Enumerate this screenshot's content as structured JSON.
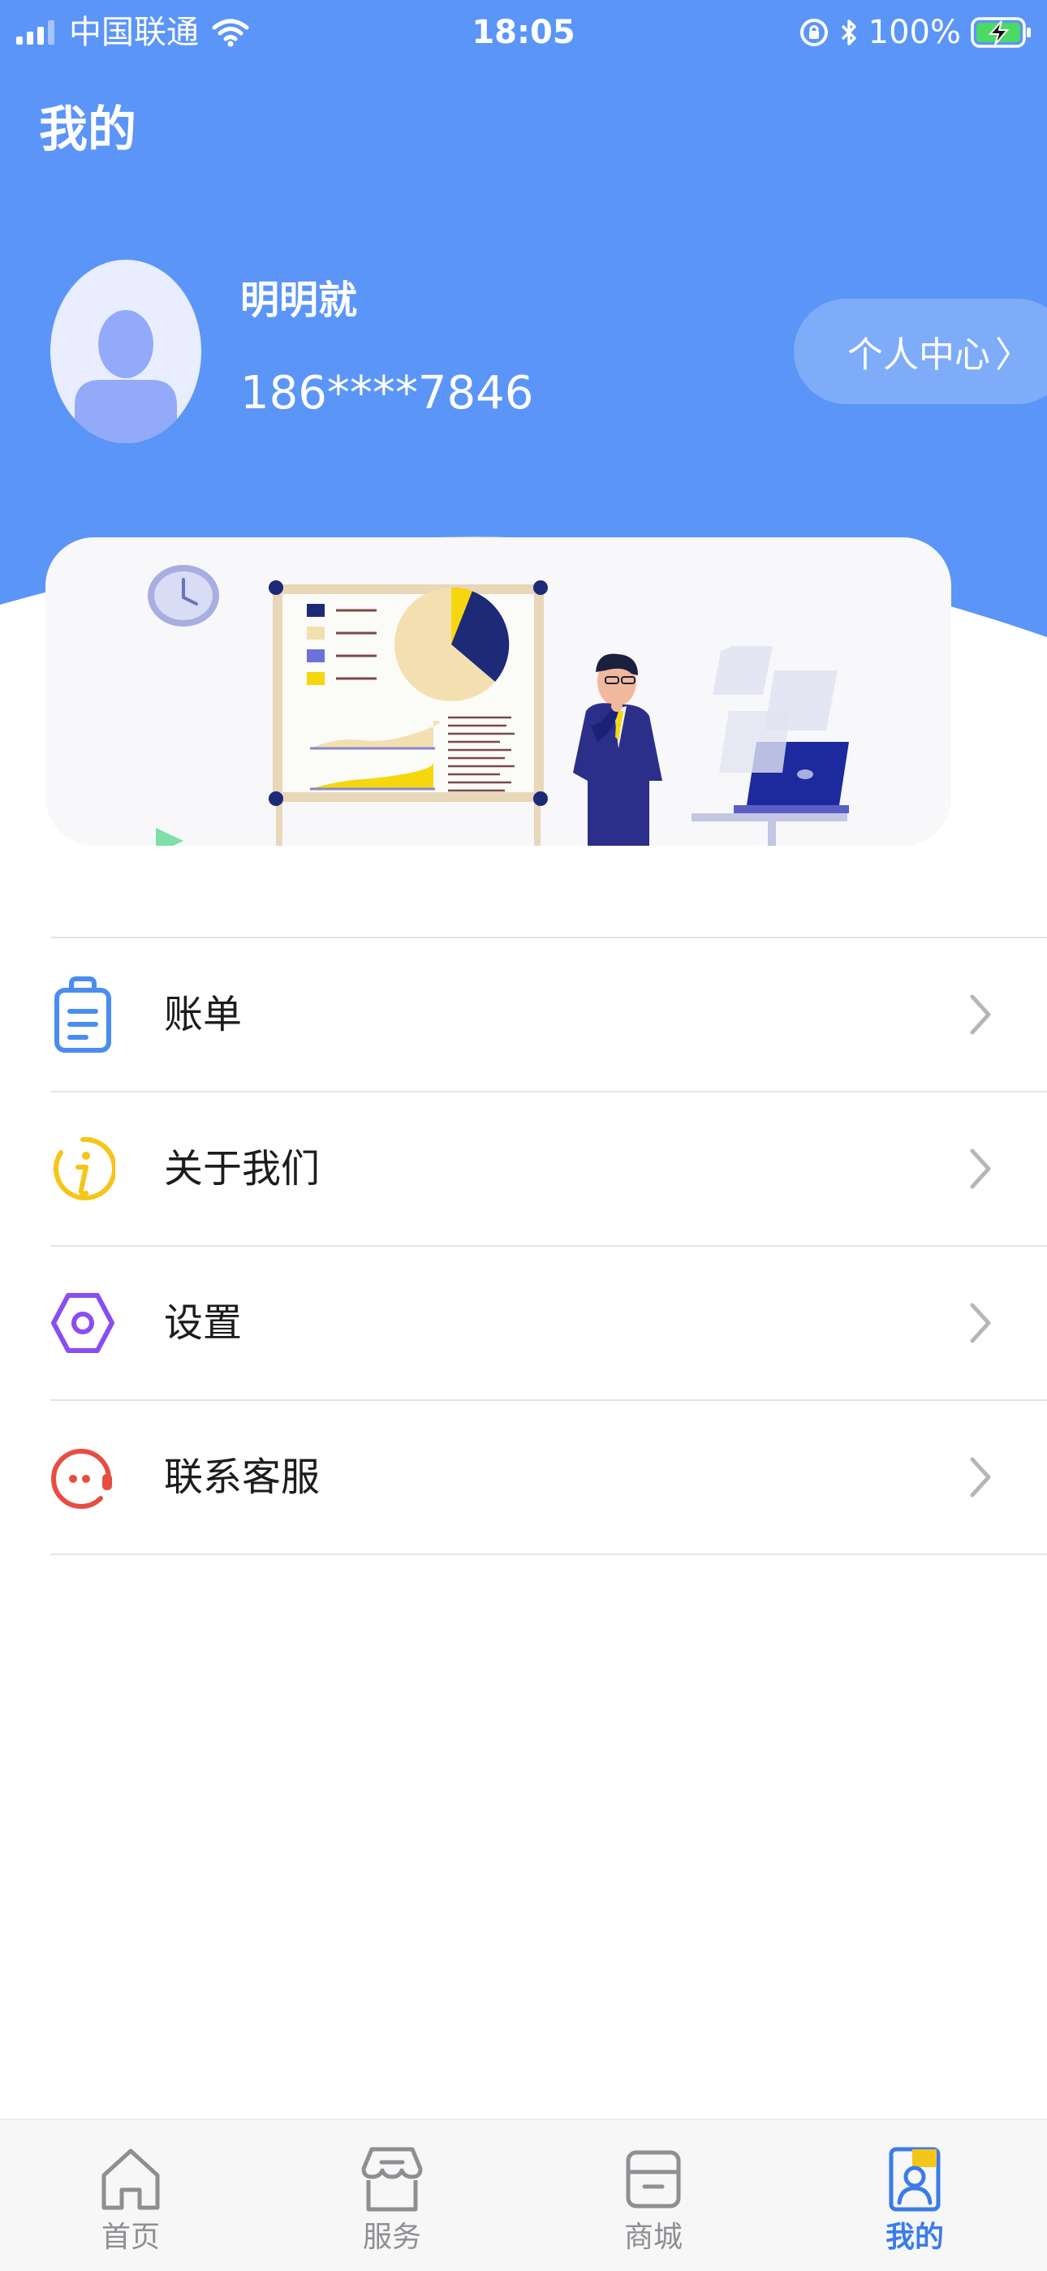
{
  "status_bar": {
    "carrier": "中国联通",
    "time": "18:05",
    "battery": "100%"
  },
  "header": {
    "title": "我的",
    "background_color": "#5b95f8"
  },
  "profile": {
    "name": "明明就",
    "phone": "186****7846",
    "center_button": "个人中心",
    "center_arrow": "〉"
  },
  "menu": {
    "items": [
      {
        "label": "账单",
        "icon": "bill-clipboard-icon",
        "color": "#4a8df0"
      },
      {
        "label": "关于我们",
        "icon": "info-circle-icon",
        "color": "#f5c518"
      },
      {
        "label": "设置",
        "icon": "settings-hexagon-icon",
        "color": "#8a4df2"
      },
      {
        "label": "联系客服",
        "icon": "customer-service-icon",
        "color": "#e84d43"
      }
    ]
  },
  "tab_bar": {
    "tabs": [
      {
        "label": "首页",
        "icon": "home-icon"
      },
      {
        "label": "服务",
        "icon": "store-icon"
      },
      {
        "label": "商城",
        "icon": "box-icon"
      },
      {
        "label": "我的",
        "icon": "profile-icon",
        "active": true
      }
    ],
    "active_color": "#3a7ce8",
    "inactive_color": "#8e8e93"
  }
}
